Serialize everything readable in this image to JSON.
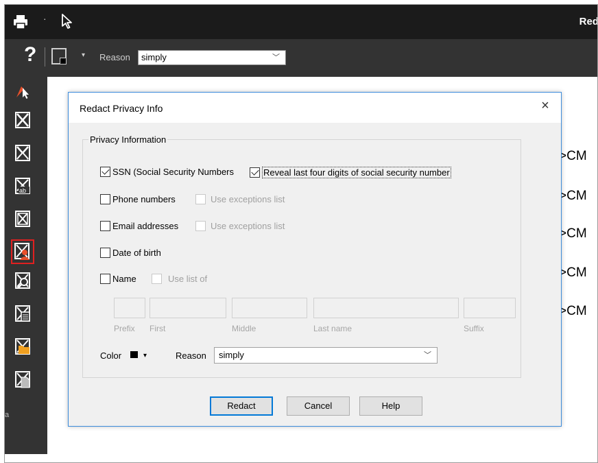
{
  "app": {
    "title_fragment": "Red",
    "toolbar": {
      "help_symbol": "?",
      "reason_label": "Reason",
      "reason_value": "simply"
    },
    "sidebar_tools": [
      "pointer-redact-icon",
      "redact-area-icon",
      "redact-text-icon",
      "redact-ab-icon",
      "redact-page-icon",
      "redact-privacy-icon",
      "redact-search-icon",
      "redact-metadata-icon",
      "redact-folder-icon",
      "redact-document-icon"
    ],
    "selected_tool": "redact-privacy-icon",
    "document_lines": [
      ">CM",
      ">CM",
      ">CM",
      ">CM",
      ">CM"
    ],
    "colors": {
      "accent": "#0078d7",
      "selection": "#e02020",
      "dark_bg": "#333333"
    }
  },
  "dialog": {
    "title": "Redact Privacy Info",
    "close_symbol": "×",
    "group_title": "Privacy Information",
    "ssn": {
      "label": "SSN (Social Security Numbers",
      "checked": true
    },
    "reveal": {
      "label": "Reveal last four digits of social security number",
      "checked": true
    },
    "phone": {
      "label": "Phone numbers",
      "checked": false,
      "exceptions_label": "Use exceptions list"
    },
    "email": {
      "label": "Email addresses",
      "checked": false,
      "exceptions_label": "Use exceptions list"
    },
    "dob": {
      "label": "Date of birth",
      "checked": false
    },
    "name": {
      "label": "Name",
      "checked": false,
      "use_list_label": "Use list of"
    },
    "name_fields": {
      "prefix": "Prefix",
      "first": "First",
      "middle": "Middle",
      "last": "Last name",
      "suffix": "Suffix"
    },
    "color_label": "Color",
    "reason_label": "Reason",
    "reason_value": "simply",
    "buttons": {
      "redact": "Redact",
      "cancel": "Cancel",
      "help": "Help"
    }
  }
}
